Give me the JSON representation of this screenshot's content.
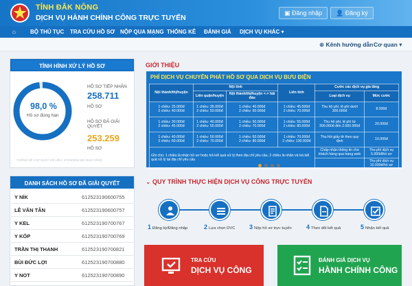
{
  "header": {
    "province": "TỈNH ĐẮK NÔNG",
    "portal": "DỊCH VỤ HÀNH CHÍNH CÔNG TRỰC TUYẾN",
    "login": "Đăng nhập",
    "register": "Đăng ký"
  },
  "nav": {
    "items": [
      "BỘ THỦ TỤC",
      "TRA CỨU HỒ SƠ",
      "NỘP QUA MẠNG",
      "THỐNG KÊ",
      "ĐÁNH GIÁ",
      "DỊCH VỤ KHÁC"
    ]
  },
  "subnav": {
    "guide": "Kênh hướng dẫn",
    "agency": "Cơ quan"
  },
  "status": {
    "title": "TÌNH HÌNH XỬ LÝ HỒ SƠ",
    "percent": "98,0 %",
    "percent_label": "Hồ sơ đúng hạn",
    "received_label": "HỒ SƠ TIẾP NHẬN",
    "received": "258.711",
    "received_unit": "HỒ SƠ",
    "resolved_label": "HỒ SƠ ĐÃ GIẢI QUYẾT",
    "resolved": "253.259",
    "resolved_unit": "HỒ SƠ",
    "note": "THỐNG KÊ CẬP NHẬT SỐ LIỆU: 27/03/2019 (ĐÃ BAO GỒM)",
    "fraction": 0.98
  },
  "resolved_list": {
    "title": "DANH SÁCH HỒ SƠ ĐÃ GIẢI QUYẾT",
    "rows": [
      {
        "name": "Y NÍK",
        "code": "612523190600755"
      },
      {
        "name": "LÊ VĂN TÂN",
        "code": "612523190600757"
      },
      {
        "name": "Y KEL",
        "code": "612523190700767"
      },
      {
        "name": "Y KÓP",
        "code": "612523190700769"
      },
      {
        "name": "TRẦN THỊ THANH",
        "code": "612523190700821"
      },
      {
        "name": "BÙI ĐỨC LỢI",
        "code": "612523190700880"
      },
      {
        "name": "Y NOT",
        "code": "612523190700890"
      }
    ]
  },
  "intro": {
    "title": "GIỚI THIỆU",
    "fee_title": "PHÍ DỊCH VỤ CHUYỂN PHÁT HỒ SƠ QUA DỊCH VỤ BƯU ĐIỆN"
  },
  "fee_table": {
    "h_noitinh": "Nội tỉnh",
    "h_lientinh": "Liên tỉnh",
    "h_cuoc": "Cước các dịch vụ gia tăng",
    "h_noithanh": "Nội thành/thị/huyện",
    "h_lienquan": "Liên quận/huyện",
    "h_haidao": "Nội thành/thị/huyện <-> hải đảo",
    "h_loaidv": "Loại dịch vụ",
    "h_muccuoc": "Mức cước",
    "r1": [
      "1 chiều: 25.000đ\n2 chiều: 40.000đ",
      "1 chiều: 35.000đ\n2 chiều: 50.000đ",
      "1 chiều: 40.000đ\n2 chiều: 60.000đ",
      "1 chiều: 45.000đ\n2 chiều: 70.000đ",
      "Thu hộ phí, lệ phí dưới 300.000đ",
      "8.000đ"
    ],
    "r2": [
      "1 chiều: 30.000đ\n2 chiều: 45.000đ",
      "1 chiều: 40.000đ\n2 chiều: 55.000đ",
      "1 chiều: 50.000đ\n2 chiều: 70.000đ",
      "1 chiều: 55.000đ\n2 chiều: 80.000đ",
      "Thu hộ phí, lệ phí từ 300.000đ đến 2.000.000đ",
      "20.000đ"
    ],
    "r3": [
      "1 chiều: 40.000đ\n2 chiều: 60.000đ",
      "1 chiều: 50.000đ\n2 chiều: 70.000đ",
      "1 chiều: 60.000đ\n2 chiều: 80.000đ",
      "1 chiều: 70.000đ\n2 chiều: 130.000đ",
      "Thu hồi giấy tờ theo quy định",
      "10.000đ"
    ],
    "note": "Ghi chú: 1 chiều là nhận hồ sơ hoặc trả kết quả xử lý theo địa chỉ yêu cầu, 2 chiều là nhận và trả kết quả xử lý tại địa chỉ yêu cầu",
    "r4": [
      "Chấp nhận thông tin cho khách hàng qua trang web",
      "Thu phí dịch vụ 5.000đ/hồ sơ"
    ],
    "r5": [
      "",
      "Thu phí dịch vụ 10.000đ/hồ sơ"
    ]
  },
  "process": {
    "title": "QUY TRÌNH THỰC HIỆN DỊCH VỤ CÔNG TRỰC TUYẾN",
    "steps": [
      {
        "n": "1",
        "label": "Đăng ký/Đăng nhập",
        "icon": "user-network-icon"
      },
      {
        "n": "2",
        "label": "Lựa chọn DVC",
        "icon": "list-icon"
      },
      {
        "n": "3",
        "label": "Nộp hồ sơ trực tuyến",
        "icon": "form-icon"
      },
      {
        "n": "4",
        "label": "Theo dõi kết quả",
        "icon": "document-icon"
      },
      {
        "n": "5",
        "label": "Nhận kết quả",
        "icon": "checkbox-icon"
      }
    ]
  },
  "cards": {
    "lookup_l1": "TRA CỨU",
    "lookup_l2": "DỊCH VỤ CÔNG",
    "eval_l1": "ĐÁNH GIÁ DỊCH VỤ",
    "eval_l2": "HÀNH CHÍNH CÔNG"
  },
  "colors": {
    "primary": "#1670c2",
    "accent_yellow": "#ffe94a",
    "red": "#d9312b",
    "green": "#21a44f",
    "orange": "#f0a12a",
    "cyan": "#2aa0e0"
  }
}
